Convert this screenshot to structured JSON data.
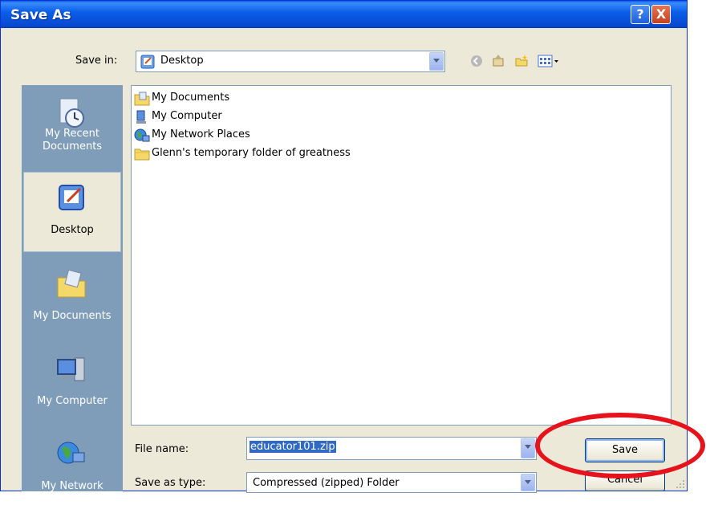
{
  "window": {
    "title": "Save As",
    "help_label": "?",
    "close_label": "X"
  },
  "toolbar": {
    "save_in_label": "Save in:",
    "save_in_value": "Desktop"
  },
  "places": [
    {
      "label": "My Recent Documents",
      "line1": "My Recent",
      "line2": "Documents"
    },
    {
      "label": "Desktop",
      "selected": true
    },
    {
      "label": "My Documents"
    },
    {
      "label": "My Computer"
    },
    {
      "label": "My Network"
    }
  ],
  "files": [
    {
      "label": "My Documents",
      "icon": "my-documents-icon"
    },
    {
      "label": "My Computer",
      "icon": "my-computer-icon"
    },
    {
      "label": "My Network Places",
      "icon": "my-network-places-icon"
    },
    {
      "label": "Glenn's temporary folder of greatness",
      "icon": "folder-icon"
    }
  ],
  "form": {
    "file_name_label": "File name:",
    "file_name_value": "educator101.zip",
    "save_as_type_label": "Save as type:",
    "save_as_type_value": "Compressed (zipped) Folder"
  },
  "buttons": {
    "save": "Save",
    "cancel": "Cancel"
  },
  "colors": {
    "title_blue": "#0b5fe9",
    "dialog_bg": "#ece9d8",
    "highlight_ring": "#e6131c",
    "selection": "#316ac5"
  }
}
